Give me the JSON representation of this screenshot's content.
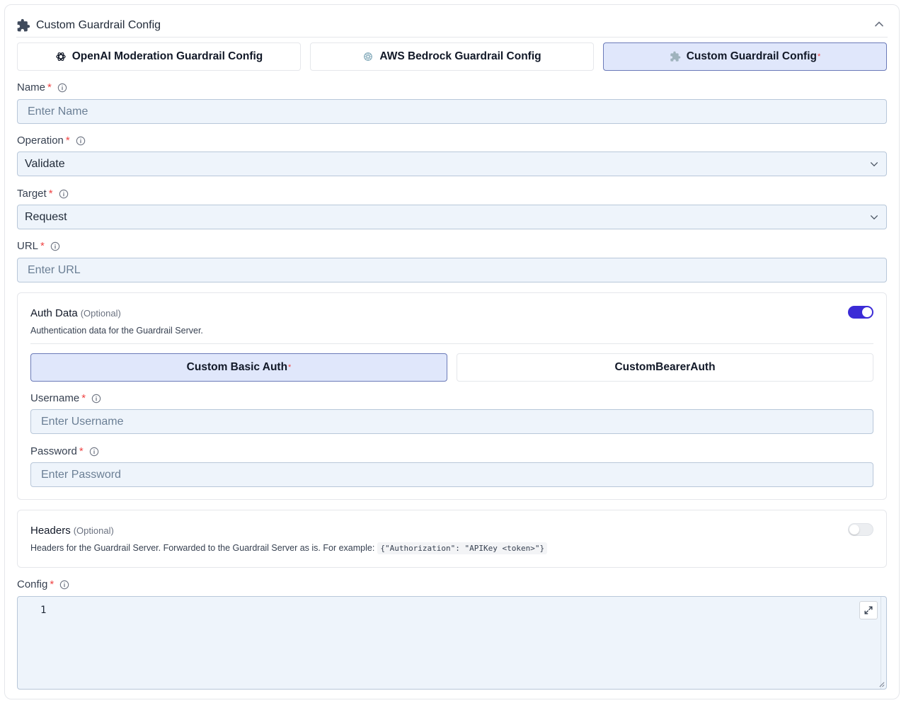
{
  "panel": {
    "title": "Custom Guardrail Config"
  },
  "tabs": [
    {
      "label": "OpenAI Moderation Guardrail Config",
      "icon": "openai-icon",
      "active": false,
      "required": false
    },
    {
      "label": "AWS Bedrock Guardrail Config",
      "icon": "aws-bedrock-icon",
      "active": false,
      "required": false
    },
    {
      "label": "Custom Guardrail Config",
      "icon": "puzzle-icon",
      "active": true,
      "required": true
    }
  ],
  "required_mark": "*",
  "fields": {
    "name": {
      "label": "Name",
      "placeholder": "Enter Name"
    },
    "operation": {
      "label": "Operation",
      "value": "Validate"
    },
    "target": {
      "label": "Target",
      "value": "Request"
    },
    "url": {
      "label": "URL",
      "placeholder": "Enter URL"
    },
    "config": {
      "label": "Config",
      "line_number": "1"
    }
  },
  "auth": {
    "title": "Auth Data",
    "optional": "(Optional)",
    "description": "Authentication data for the Guardrail Server.",
    "enabled": true,
    "subtabs": [
      {
        "label": "Custom Basic Auth",
        "active": true,
        "required": true
      },
      {
        "label": "CustomBearerAuth",
        "active": false,
        "required": false
      }
    ],
    "username": {
      "label": "Username",
      "placeholder": "Enter Username"
    },
    "password": {
      "label": "Password",
      "placeholder": "Enter Password"
    }
  },
  "headers": {
    "title": "Headers",
    "optional": "(Optional)",
    "description": "Headers for the Guardrail Server. Forwarded to the Guardrail Server as is. For example:",
    "example": "{\"Authorization\": \"APIKey <token>\"}",
    "enabled": false
  },
  "colors": {
    "accent": "#3b2bd6",
    "active_tab_bg": "#e0e7fb",
    "input_bg": "#eef4fb",
    "required": "#ef4444"
  }
}
